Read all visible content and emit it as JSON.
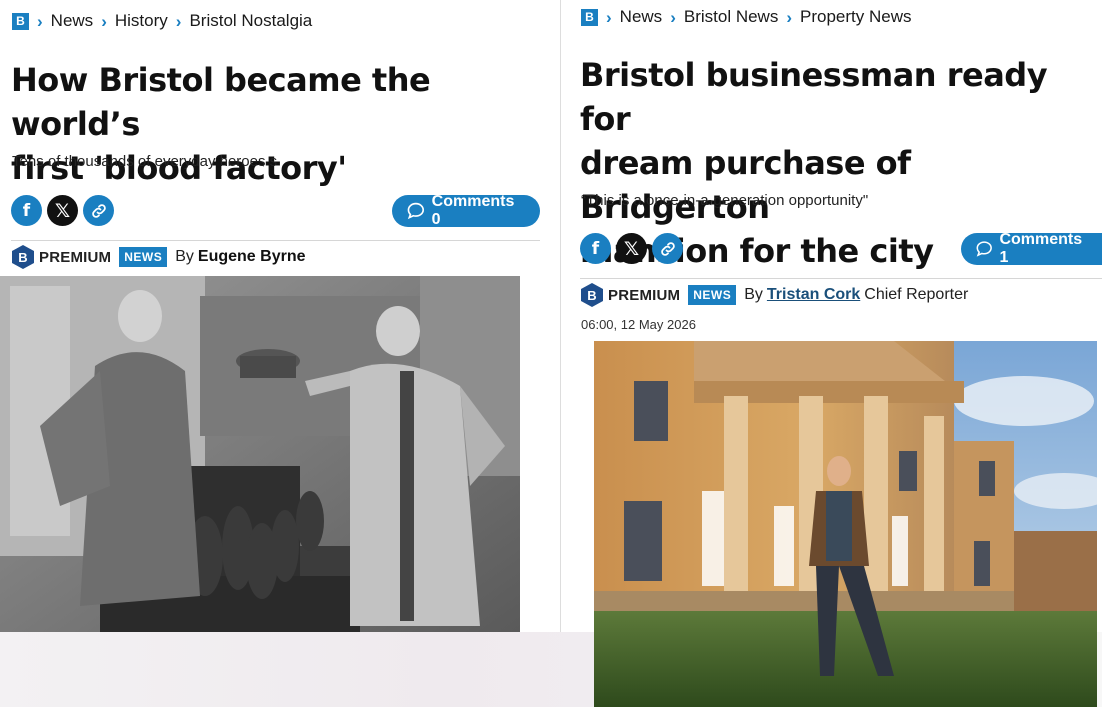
{
  "left_article": {
    "brand_letter": "B",
    "breadcrumbs": [
      "News",
      "History",
      "Bristol Nostalgia"
    ],
    "headline_line1": "How Bristol became the world’s",
    "headline_line2": "first 'blood factory'",
    "standfirst": "Tens of thousands of everyday heroes s",
    "comments_label": "Comments 0",
    "premium_label": "PREMIUM",
    "news_badge": "NEWS",
    "by_label": "By",
    "author": "Eugene Byrne"
  },
  "right_article": {
    "brand_letter": "B",
    "breadcrumbs": [
      "News",
      "Bristol News",
      "Property News"
    ],
    "headline_line1": "Bristol businessman ready for",
    "headline_line2": "dream purchase of Bridgerton",
    "headline_line3": "mansion for the city",
    "standfirst": "“This is a once-in-a-generation opportunity\"",
    "comments_label": "Comments 1",
    "premium_label": "PREMIUM",
    "news_badge": "NEWS",
    "by_label": "By",
    "author": "Tristan Cork",
    "author_role": "Chief Reporter",
    "dateline": "06:00, 12 May 2026"
  },
  "colors": {
    "brand_blue": "#1a7fc1",
    "premium_navy": "#1f4e8c"
  },
  "icons": [
    "facebook-icon",
    "x-icon",
    "link-icon",
    "speech-bubble-icon",
    "chevron-right-icon"
  ]
}
